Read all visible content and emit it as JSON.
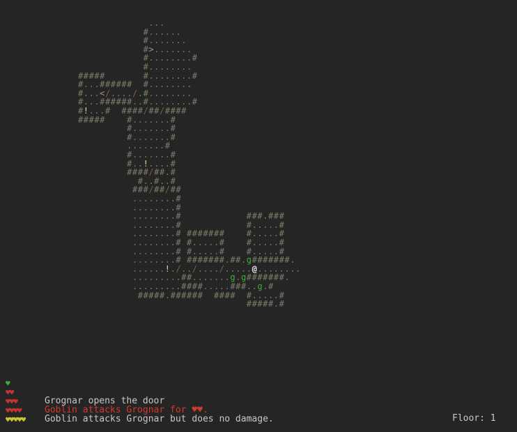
{
  "colors": {
    "background": "#252525",
    "wall": "#7d7d6a",
    "floor": "#7a7a68",
    "door": "#8a5a3a",
    "stairs": "#9a9a9a",
    "item": "#d8d8a0",
    "goblin": "#3fae3f",
    "player": "#e8e8e8",
    "message_normal": "#c8c8c8",
    "message_alert": "#d23a2a",
    "heart_green": "#3fae3f",
    "heart_red": "#c83232",
    "heart_yellow": "#c8c832"
  },
  "legend": {
    "wall": "#",
    "floor": ".",
    "door": "/",
    "stairs_down": ">",
    "stairs_up": "<",
    "item": "!",
    "goblin": "g",
    "player": "@"
  },
  "map_rows": [
    "                    ...                            ",
    "                   #......                         ",
    "                   #.......                        ",
    "                   #>.......                       ",
    "                   #........#                      ",
    "                   #........                       ",
    "       #####       #........#                      ",
    "       #...######  #........                       ",
    "       #...</..../.#........                       ",
    "       #...######..#........#                      ",
    "       #!...#  ####/##/####                        ",
    "       #####    #.......#                          ",
    "                #.......#                          ",
    "                #.......#                          ",
    "                .......#                           ",
    "                #.......#                          ",
    "                #..!....#                          ",
    "                ####/##.#                          ",
    "                  #..#..#                          ",
    "                 ###/##/##                         ",
    "                 ........#                         ",
    "                 ........#                         ",
    "                 ........#            ###.###      ",
    "                 ........#            #.....#      ",
    "                 ........# #######    #.....#      ",
    "                 ........# #.....#    #.....#      ",
    "                 ........# #.....#    #.....#      ",
    "                 ........# #######.##.g#######.    ",
    "                 ......!./../..../.....@........   ",
    "                 .........##.......g.g#######.     ",
    "                 .........####.....###..g.#        ",
    "                  #####.######  ####  #.....#      ",
    "                                      #####.#      "
  ],
  "map_origin_note": "",
  "messages": [
    {
      "hearts": "♥",
      "hearts_color": "heart_green",
      "text": "",
      "color": "message_normal"
    },
    {
      "hearts": "♥♥",
      "hearts_color": "heart_red",
      "text": "",
      "color": "message_normal"
    },
    {
      "hearts": "♥♥♥",
      "hearts_color": "heart_red",
      "text": "Grognar opens the door",
      "color": "message_normal"
    },
    {
      "hearts": "♥♥♥♥",
      "hearts_color": "heart_red",
      "text": "Goblin attacks Grognar for ♥♥.",
      "color": "message_alert"
    },
    {
      "hearts": "♥♥♥♥♥",
      "hearts_color": "heart_yellow",
      "text": "Goblin attacks Grognar but does no damage.",
      "color": "message_normal"
    }
  ],
  "floor_label": "Floor: 1"
}
